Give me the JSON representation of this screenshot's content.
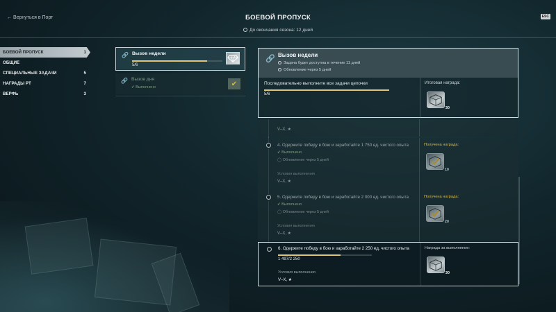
{
  "header": {
    "back_label": "← Вернуться в Порт",
    "title": "БОЕВОЙ ПРОПУСК",
    "season_text": "До окончания сезона: 12 дней",
    "esc_label": "ESC"
  },
  "sidebar": {
    "items": [
      {
        "label": "БОЕВОЙ ПРОПУСК",
        "count": "1"
      },
      {
        "label": "ОБЩИЕ",
        "count": ""
      },
      {
        "label": "СПЕЦИАЛЬНЫЕ ЗАДАЧИ",
        "count": "5"
      },
      {
        "label": "НАГРАДЫ РТ",
        "count": "7"
      },
      {
        "label": "ВЕРФЬ",
        "count": "3"
      }
    ]
  },
  "challenges": {
    "weekly": {
      "title": "Вызов недели",
      "progress": "5/6",
      "progress_fraction": 0.83
    },
    "daily": {
      "title": "Вызов дня",
      "status": "Выполнено",
      "check_glyph": "✔"
    }
  },
  "detail": {
    "title": "Вызов недели",
    "availability": "Задача будет доступна в течение 11 дней",
    "refresh": "Обновление через 5 дней",
    "chain_text": "Последовательно выполните все задачи цепочки",
    "chain_progress": "5/6",
    "chain_fraction": 1.0,
    "final_reward_label": "Итоговая награда:",
    "final_reward_qty": "30"
  },
  "tasks": {
    "top_partial": {
      "condition_value": "V–X, ★"
    },
    "t4": {
      "title": "4. Одержите победу в бою и заработайте 1 750 ед. чистого опыта",
      "status": "✔ Выполнено",
      "refresh": "Обновление через 5 дней",
      "condition_label": "Условия выполнения",
      "condition_value": "V–X, ★",
      "reward_label": "Получена награда:",
      "reward_qty": "10"
    },
    "t5": {
      "title": "5. Одержите победу в бою и заработайте 2 000 ед. чистого опыта",
      "status": "✔ Выполнено",
      "refresh": "Обновление через 5 дней",
      "condition_label": "Условия выполнения",
      "condition_value": "V–X, ★",
      "reward_label": "Получена награда:",
      "reward_qty": "20"
    },
    "t6": {
      "title": "6. Одержите победу в бою и заработайте 2 250 ед. чистого опыта",
      "progress": "1 497/2 250",
      "progress_fraction": 0.665,
      "condition_label": "Условия выполнения",
      "condition_value": "V–X, ★",
      "reward_label": "Награда за выполнение:",
      "reward_qty": "30"
    }
  },
  "icons": {
    "link": "link-icon",
    "clock": "clock-icon",
    "gem": "diamond-icon",
    "container": "reward-container-icon"
  },
  "colors": {
    "accent_gold": "#e0c67a",
    "received_label": "#d8b84b",
    "done_green": "#7f9a80"
  }
}
